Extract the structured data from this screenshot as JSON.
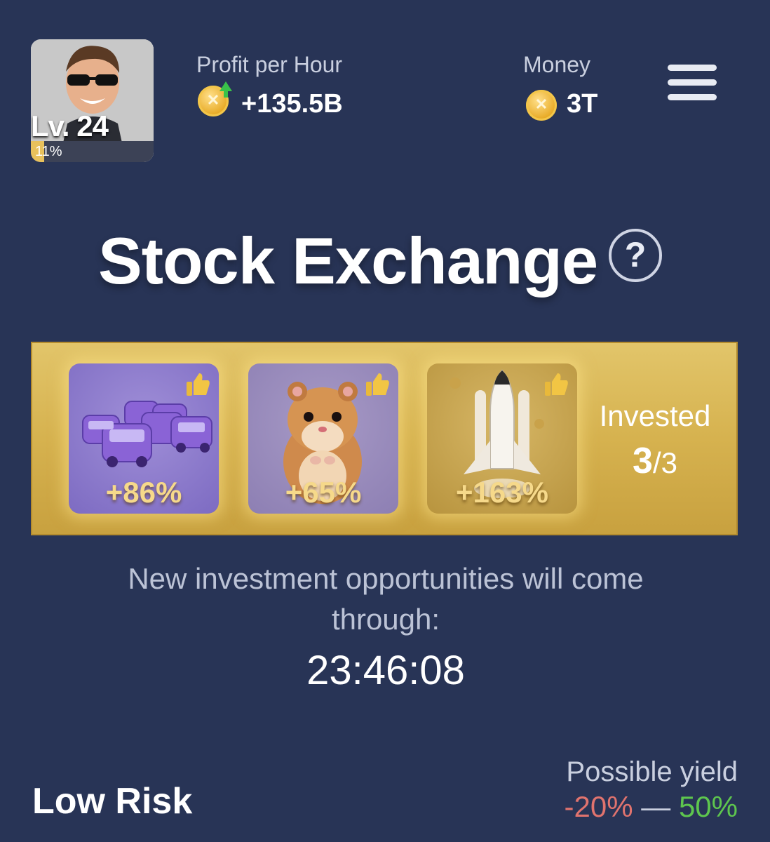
{
  "player": {
    "level_label": "Lv. 24",
    "xp_percent_label": "11%",
    "xp_fraction": 0.11
  },
  "profit": {
    "label": "Profit per Hour",
    "value": "+135.5B"
  },
  "money": {
    "label": "Money",
    "value": "3T"
  },
  "title": "Stock Exchange",
  "help_symbol": "?",
  "investments": {
    "cards": [
      {
        "name": "taxis",
        "percent": "+86%"
      },
      {
        "name": "hamster",
        "percent": "+65%"
      },
      {
        "name": "rocket",
        "percent": "+163%"
      }
    ],
    "invested_label": "Invested",
    "invested_count": "3",
    "invested_total": "/3"
  },
  "info_text": "New investment opportunities will come through:",
  "timer": "23:46:08",
  "risk": {
    "title": "Low Risk",
    "yield_label": "Possible yield",
    "yield_min": "-20%",
    "yield_sep": " — ",
    "yield_max": "50%"
  },
  "colors": {
    "background": "#283456",
    "gold": "#d6b24f",
    "negative": "#e0736e",
    "positive": "#5ec64e"
  },
  "icons": [
    "coin-icon",
    "up-arrow-icon",
    "menu-icon",
    "help-icon",
    "thumbs-up-icon"
  ]
}
